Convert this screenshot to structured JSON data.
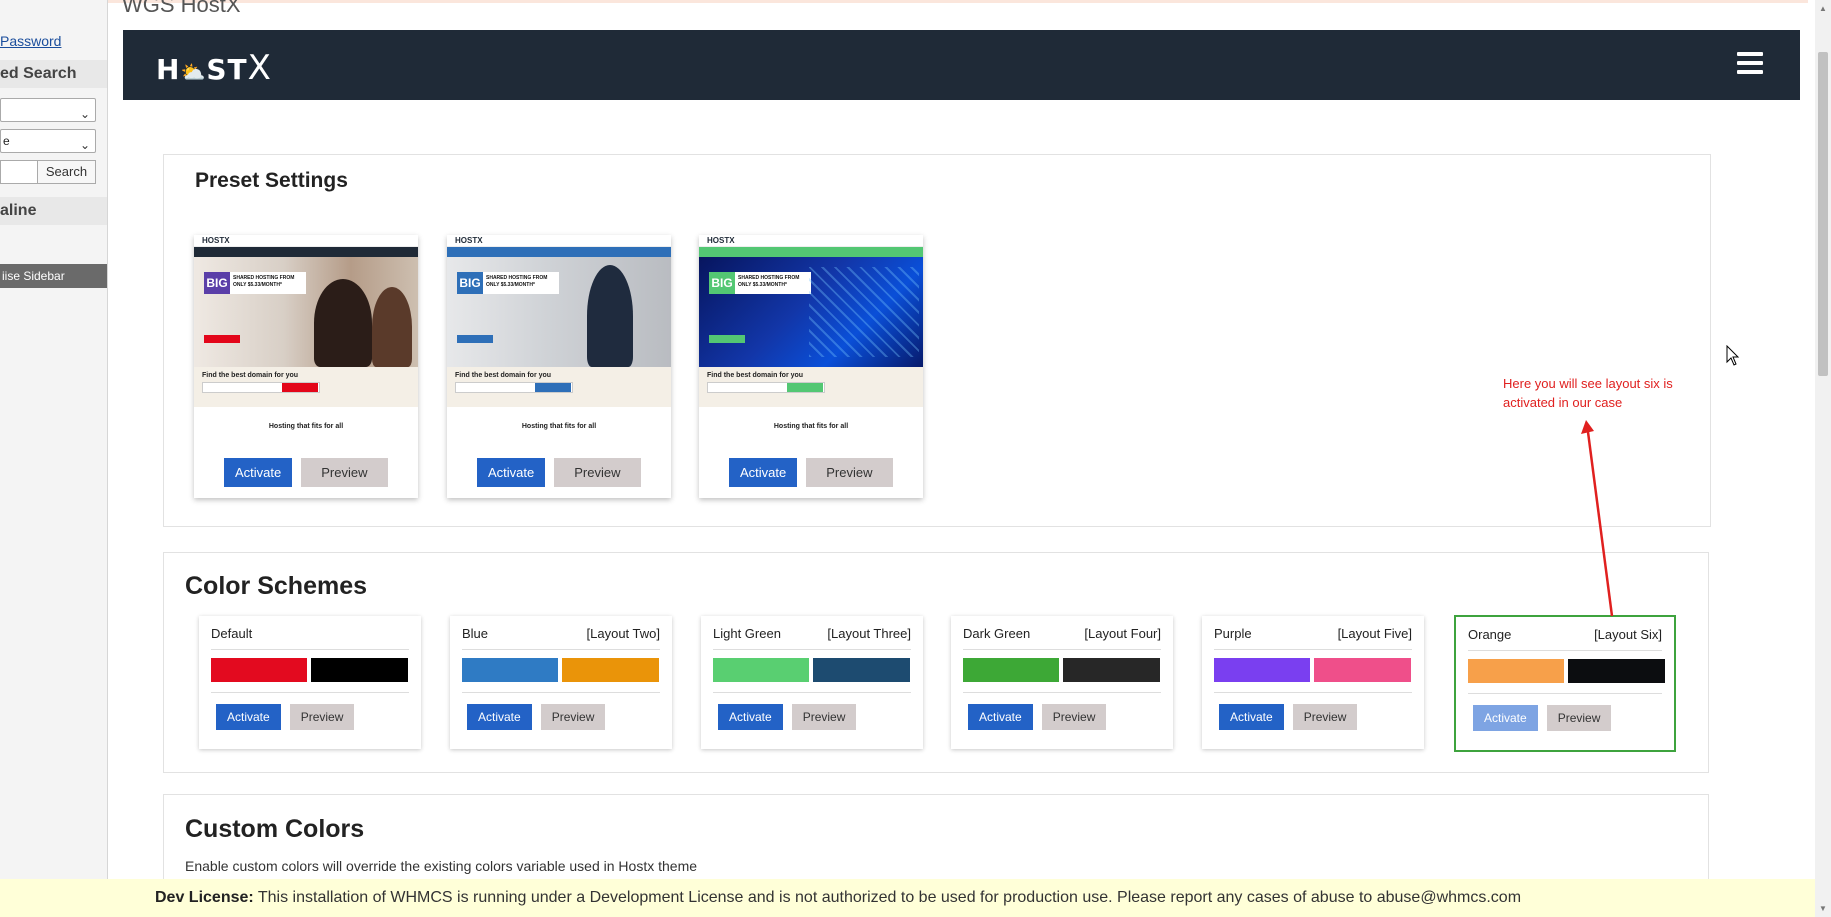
{
  "sidebar": {
    "password_link": "Password",
    "advanced_search_heading": "ed Search",
    "select1_value": "",
    "select2_value": "e",
    "search_button": "Search",
    "online_heading": "aline",
    "minimise_label": "iise Sidebar"
  },
  "page": {
    "title": "WGS HostX"
  },
  "header": {
    "logo_text": "H",
    "logo_o": "⛅",
    "logo_st": "ST",
    "logo_x": "X",
    "menu_icon": "hamburger-icon"
  },
  "preset": {
    "heading": "Preset Settings",
    "cards": [
      {
        "brand": "HOSTX",
        "big": "BIG",
        "shared": "SHARED HOSTING FROM ONLY $5.33/MONTH*",
        "domain_title": "Find the best domain for you",
        "hosting_title": "Hosting that fits for all",
        "accent": "#e3061a",
        "activate": "Activate",
        "preview": "Preview"
      },
      {
        "brand": "HOSTX",
        "big": "BIG",
        "shared": "SHARED HOSTING FROM ONLY $5.33/MONTH*",
        "domain_title": "Find the best domain for you",
        "hosting_title": "Hosting that fits for all",
        "accent": "#2e6fb8",
        "activate": "Activate",
        "preview": "Preview"
      },
      {
        "brand": "HOSTX",
        "big": "BIG",
        "shared": "SHARED HOSTING FROM ONLY $5.33/MONTH*",
        "domain_title": "Find the best domain for you",
        "hosting_title": "Hosting that fits for all",
        "accent": "#53c773",
        "activate": "Activate",
        "preview": "Preview"
      }
    ]
  },
  "color_schemes": {
    "heading": "Color Schemes",
    "cards": [
      {
        "name": "Default",
        "layout": "",
        "colors": [
          "#e30a1f",
          "#000000"
        ],
        "activate": "Activate",
        "preview": "Preview",
        "active": false
      },
      {
        "name": "Blue",
        "layout": "[Layout Two]",
        "colors": [
          "#2f7bc4",
          "#ea9409"
        ],
        "activate": "Activate",
        "preview": "Preview",
        "active": false
      },
      {
        "name": "Light Green",
        "layout": "[Layout Three]",
        "colors": [
          "#59cf71",
          "#1d4b70"
        ],
        "activate": "Activate",
        "preview": "Preview",
        "active": false
      },
      {
        "name": "Dark Green",
        "layout": "[Layout Four]",
        "colors": [
          "#3da836",
          "#272727"
        ],
        "activate": "Activate",
        "preview": "Preview",
        "active": false
      },
      {
        "name": "Purple",
        "layout": "[Layout Five]",
        "colors": [
          "#7a3ff0",
          "#ef4f8a"
        ],
        "activate": "Activate",
        "preview": "Preview",
        "active": false
      },
      {
        "name": "Orange",
        "layout": "[Layout Six]",
        "colors": [
          "#f7a04a",
          "#0c0d10"
        ],
        "activate": "Activate",
        "preview": "Preview",
        "active": true
      }
    ]
  },
  "custom_colors": {
    "heading": "Custom Colors",
    "description": "Enable custom colors will override the existing colors variable used in Hostx theme"
  },
  "annotation": {
    "line1": "Here you will see layout six is",
    "line2": "activated in our case",
    "color": "#e0201f"
  },
  "dev_license": {
    "label": "Dev License:",
    "text": " This installation of WHMCS is running under a Development License and is not authorized to be used for production use. Please report any cases of abuse to abuse@whmcs.com"
  }
}
